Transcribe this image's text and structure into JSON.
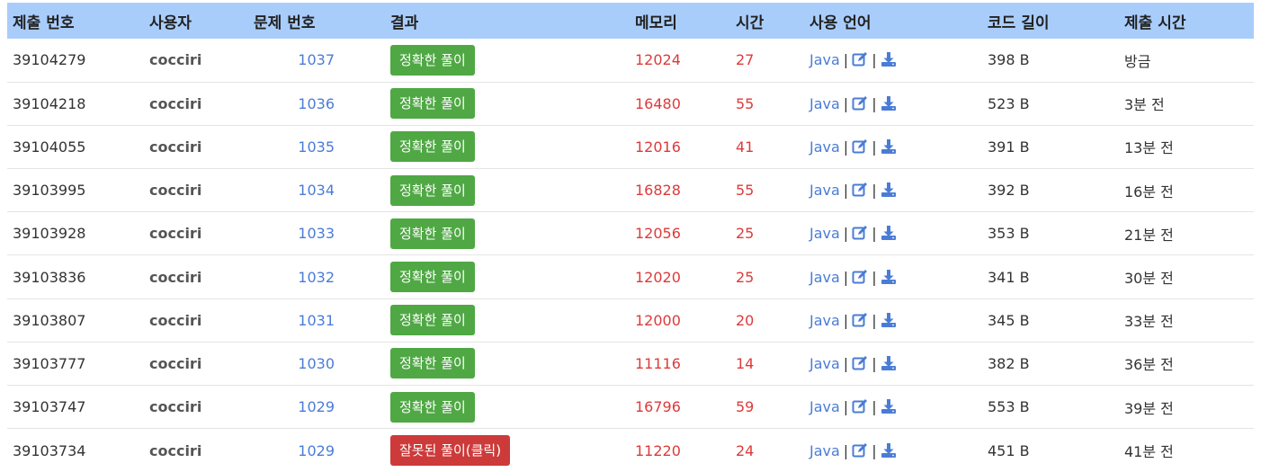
{
  "headers": [
    "제출 번호",
    "사용자",
    "문제 번호",
    "결과",
    "메모리",
    "시간",
    "사용 언어",
    "코드 길이",
    "제출 시간"
  ],
  "rows": [
    {
      "id": "39104279",
      "user": "cocciri",
      "problem": "1037",
      "result": "정확한 풀이",
      "status": "ac",
      "memory": "12024",
      "time": "27",
      "lang": "Java",
      "length": "398 B",
      "submitted": "방금"
    },
    {
      "id": "39104218",
      "user": "cocciri",
      "problem": "1036",
      "result": "정확한 풀이",
      "status": "ac",
      "memory": "16480",
      "time": "55",
      "lang": "Java",
      "length": "523 B",
      "submitted": "3분 전"
    },
    {
      "id": "39104055",
      "user": "cocciri",
      "problem": "1035",
      "result": "정확한 풀이",
      "status": "ac",
      "memory": "12016",
      "time": "41",
      "lang": "Java",
      "length": "391 B",
      "submitted": "13분 전"
    },
    {
      "id": "39103995",
      "user": "cocciri",
      "problem": "1034",
      "result": "정확한 풀이",
      "status": "ac",
      "memory": "16828",
      "time": "55",
      "lang": "Java",
      "length": "392 B",
      "submitted": "16분 전"
    },
    {
      "id": "39103928",
      "user": "cocciri",
      "problem": "1033",
      "result": "정확한 풀이",
      "status": "ac",
      "memory": "12056",
      "time": "25",
      "lang": "Java",
      "length": "353 B",
      "submitted": "21분 전"
    },
    {
      "id": "39103836",
      "user": "cocciri",
      "problem": "1032",
      "result": "정확한 풀이",
      "status": "ac",
      "memory": "12020",
      "time": "25",
      "lang": "Java",
      "length": "341 B",
      "submitted": "30분 전"
    },
    {
      "id": "39103807",
      "user": "cocciri",
      "problem": "1031",
      "result": "정확한 풀이",
      "status": "ac",
      "memory": "12000",
      "time": "20",
      "lang": "Java",
      "length": "345 B",
      "submitted": "33분 전"
    },
    {
      "id": "39103777",
      "user": "cocciri",
      "problem": "1030",
      "result": "정확한 풀이",
      "status": "ac",
      "memory": "11116",
      "time": "14",
      "lang": "Java",
      "length": "382 B",
      "submitted": "36분 전"
    },
    {
      "id": "39103747",
      "user": "cocciri",
      "problem": "1029",
      "result": "정확한 풀이",
      "status": "ac",
      "memory": "16796",
      "time": "59",
      "lang": "Java",
      "length": "553 B",
      "submitted": "39분 전"
    },
    {
      "id": "39103734",
      "user": "cocciri",
      "problem": "1029",
      "result": "잘못된 풀이(클릭)",
      "status": "wa",
      "memory": "11220",
      "time": "24",
      "lang": "Java",
      "length": "451 B",
      "submitted": "41분 전"
    }
  ],
  "icons": {
    "edit": "edit-icon",
    "download": "download-icon"
  },
  "colors": {
    "header_bg": "#a9cdfb",
    "accepted": "#4fa844",
    "wrong": "#cd3a3a",
    "link": "#4a7cd6",
    "stat": "#dd3a3a"
  }
}
